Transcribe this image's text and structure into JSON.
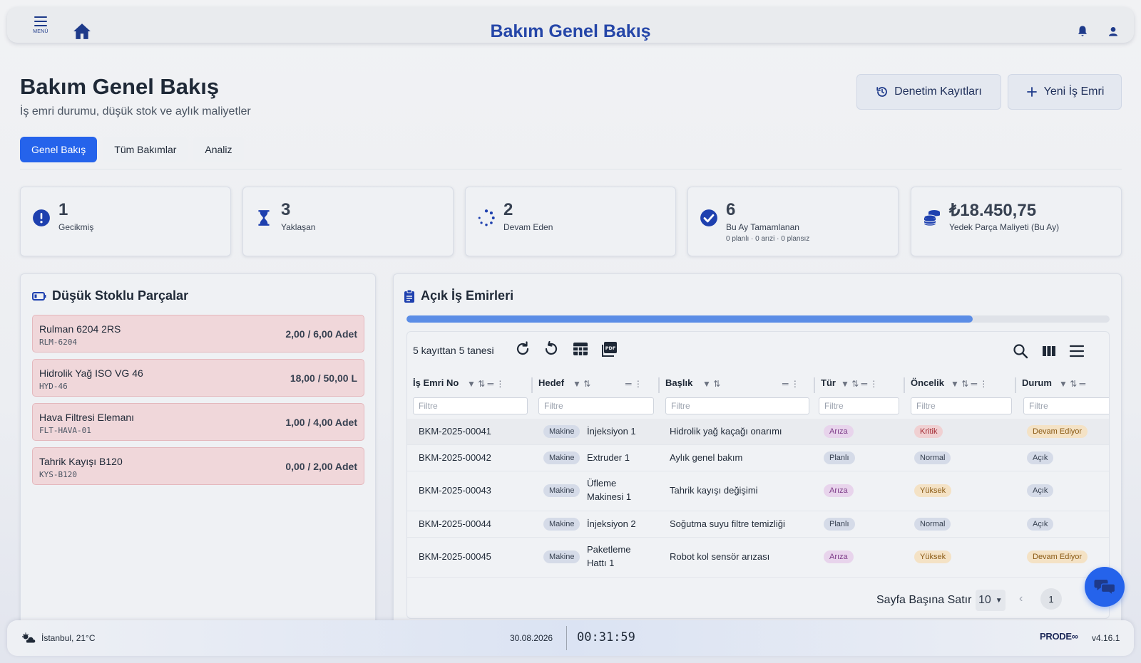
{
  "topbar": {
    "menu_label": "MENÜ",
    "title": "Bakım Genel Bakış"
  },
  "header": {
    "title": "Bakım Genel Bakış",
    "subtitle": "İş emri durumu, düşük stok ve aylık maliyetler",
    "audit_button": "Denetim Kayıtları",
    "new_button": "Yeni İş Emri"
  },
  "tabs": [
    {
      "label": "Genel Bakış",
      "active": true
    },
    {
      "label": "Tüm Bakımlar",
      "active": false
    },
    {
      "label": "Analiz",
      "active": false
    }
  ],
  "kpis": [
    {
      "value": "1",
      "label": "Gecikmiş",
      "icon": "exclamation-circle-icon",
      "color": "#1e40af"
    },
    {
      "value": "3",
      "label": "Yaklaşan",
      "icon": "hourglass-icon",
      "color": "#1e40af"
    },
    {
      "value": "2",
      "label": "Devam Eden",
      "icon": "spinner-icon",
      "color": "#1e40af"
    },
    {
      "value": "6",
      "label": "Bu Ay Tamamlanan",
      "sub": "0 planlı · 0 arızi · 0 plansız",
      "icon": "check-circle-icon",
      "color": "#1e40af"
    },
    {
      "value": "₺18.450,75",
      "label": "Yedek Parça Maliyeti (Bu Ay)",
      "icon": "coins-icon",
      "color": "#1e40af"
    }
  ],
  "low_stock": {
    "title": "Düşük Stoklu Parçalar",
    "items": [
      {
        "name": "Rulman 6204 2RS",
        "code": "RLM-6204",
        "qty": "2,00 / 6,00 Adet"
      },
      {
        "name": "Hidrolik Yağ ISO VG 46",
        "code": "HYD-46",
        "qty": "18,00 / 50,00 L"
      },
      {
        "name": "Hava Filtresi Elemanı",
        "code": "FLT-HAVA-01",
        "qty": "1,00 / 4,00 Adet"
      },
      {
        "name": "Tahrik Kayışı B120",
        "code": "KYS-B120",
        "qty": "0,00 / 2,00 Adet"
      }
    ]
  },
  "work_orders": {
    "title": "Açık İş Emirleri",
    "progress": 0.805,
    "count_text": "5 kayıttan 5 tanesi",
    "filter_placeholder": "Filtre",
    "columns": [
      "İş Emri No",
      "Hedef",
      "Başlık",
      "Tür",
      "Öncelik",
      "Durum"
    ],
    "rows": [
      {
        "no": "BKM-2025-00041",
        "target_type": "Makine",
        "target_l1": "İnjeksiyon 1",
        "target_l2": "",
        "title": "Hidrolik yağ kaçağı onarımı",
        "type": "Arıza",
        "priority": "Kritik",
        "status": "Devam Ediyor"
      },
      {
        "no": "BKM-2025-00042",
        "target_type": "Makine",
        "target_l1": "Extruder 1",
        "target_l2": "",
        "title": "Aylık genel bakım",
        "type": "Planlı",
        "priority": "Normal",
        "status": "Açık"
      },
      {
        "no": "BKM-2025-00043",
        "target_type": "Makine",
        "target_l1": "Üfleme",
        "target_l2": "Makinesi 1",
        "title": "Tahrik kayışı değişimi",
        "type": "Arıza",
        "priority": "Yüksek",
        "status": "Açık"
      },
      {
        "no": "BKM-2025-00044",
        "target_type": "Makine",
        "target_l1": "İnjeksiyon 2",
        "target_l2": "",
        "title": "Soğutma suyu filtre temizliği",
        "type": "Planlı",
        "priority": "Normal",
        "status": "Açık"
      },
      {
        "no": "BKM-2025-00045",
        "target_type": "Makine",
        "target_l1": "Paketleme",
        "target_l2": "Hattı 1",
        "title": "Robot kol sensör arızası",
        "type": "Arıza",
        "priority": "Yüksek",
        "status": "Devam Ediyor"
      }
    ],
    "rows_per_page_label": "Sayfa Başına Satır",
    "rows_per_page": "10",
    "page": "1"
  },
  "footer": {
    "weather": "İstanbul, 21°C",
    "date": "30.08.2026",
    "time": "00:31:59",
    "brand": "PRODE∞",
    "version": "v4.16.1"
  },
  "colors": {
    "accent": "#2563eb",
    "brand_blue": "#2546a8",
    "danger_bg": "#f0d7da"
  }
}
